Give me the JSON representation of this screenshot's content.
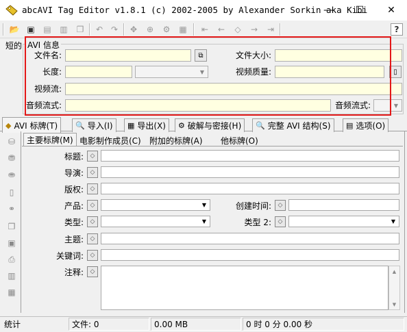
{
  "window": {
    "title": "abcAVI Tag Editor v1.8.1 (c) 2002-2005 by Alexander Sorkin aka Kibi",
    "minimize_glyph": "—",
    "maximize_glyph": "☐",
    "close_glyph": "✕"
  },
  "toolbar": {
    "icons": [
      "open-folder-icon",
      "browse-icon",
      "save-icon",
      "save-all-icon",
      "copy-tags-icon",
      "undo-icon",
      "redo-icon",
      "web-icon",
      "info-icon",
      "settings-icon",
      "apply-icon",
      "first-icon",
      "prev-icon",
      "stop-icon",
      "next-icon",
      "last-icon",
      "help-icon"
    ],
    "help_glyph": "?"
  },
  "info": {
    "side_label": "短的",
    "group_title": "AVI 信息",
    "filename_label": "文件名:",
    "filesize_label": "文件大小:",
    "length_label": "长度:",
    "video_quality_label": "视频质量:",
    "video_stream_label": "视频流:",
    "audio_stream_label": "音频流式:",
    "audio_stream2_label": "音频流式:"
  },
  "tabs": [
    {
      "label": "AVI 标牌(T)",
      "icon": "tag-icon"
    },
    {
      "label": "导入(I)",
      "icon": "import-icon"
    },
    {
      "label": "导出(X)",
      "icon": "export-icon"
    },
    {
      "label": "破解与密接(H)",
      "icon": "hack-icon"
    },
    {
      "label": "完整 AVI 结构(S)",
      "icon": "search-icon"
    },
    {
      "label": "选项(O)",
      "icon": "options-icon"
    }
  ],
  "subtabs": [
    "主要标牌(M)",
    "电影制作成员(C)",
    "附加的标牌(A)",
    "他标牌(O)"
  ],
  "fields": {
    "title": "标题:",
    "director": "导演:",
    "copyright": "版权:",
    "product": "产品:",
    "created": "创建时间:",
    "genre": "类型:",
    "genre2": "类型 2:",
    "subject": "主题:",
    "keywords": "关键词:",
    "comment": "注释:"
  },
  "status": {
    "label": "统计",
    "files": "文件: 0",
    "size": "0.00 MB",
    "time": "0 时 0 分 0.00 秒"
  }
}
